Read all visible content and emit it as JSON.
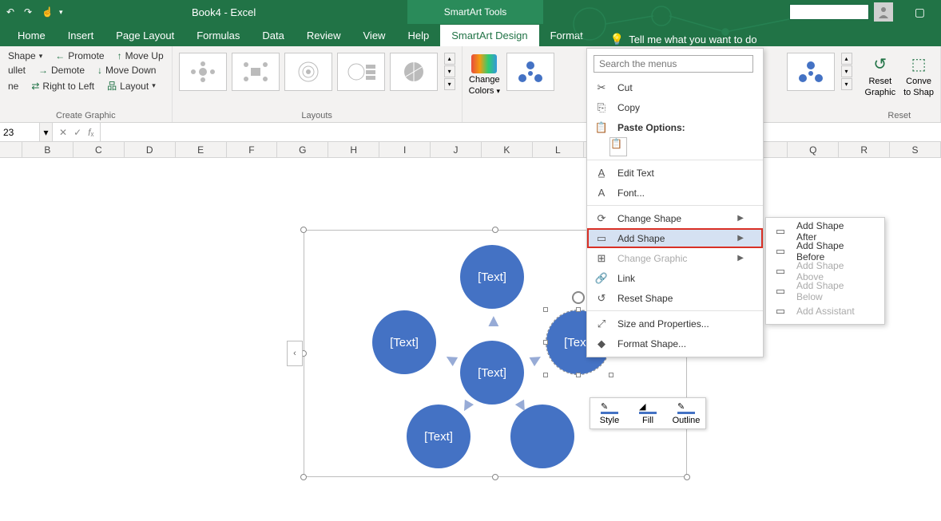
{
  "titlebar": {
    "doc_title": "Book4  -  Excel",
    "context_tool": "SmartArt Tools"
  },
  "tabs": {
    "items": [
      "Home",
      "Insert",
      "Page Layout",
      "Formulas",
      "Data",
      "Review",
      "View",
      "Help",
      "SmartArt Design",
      "Format"
    ],
    "active_index": 8,
    "tell_me": "Tell me what you want to do"
  },
  "ribbon": {
    "create_graphic": {
      "label": "Create Graphic",
      "add_shape": "Shape",
      "bullet": "ullet",
      "pane": "ne",
      "promote": "Promote",
      "demote": "Demote",
      "rtl": "Right to Left",
      "move_up": "Move Up",
      "move_down": "Move Down",
      "layout": "Layout"
    },
    "layouts_label": "Layouts",
    "change_colors": {
      "line1": "Change",
      "line2": "Colors"
    },
    "reset": {
      "label": "Reset",
      "reset_graphic_l1": "Reset",
      "reset_graphic_l2": "Graphic",
      "convert_l1": "Conve",
      "convert_l2": "to Shap"
    }
  },
  "namebox": "23",
  "columns": [
    "B",
    "C",
    "D",
    "E",
    "F",
    "G",
    "H",
    "I",
    "J",
    "K",
    "L",
    "",
    "",
    "",
    "",
    "Q",
    "R",
    "S"
  ],
  "smartart": {
    "placeholder": "[Text]"
  },
  "context_menu": {
    "search_ph": "Search the menus",
    "cut": "Cut",
    "copy": "Copy",
    "paste_options": "Paste Options:",
    "edit_text": "Edit Text",
    "font": "Font...",
    "change_shape": "Change Shape",
    "add_shape": "Add Shape",
    "change_graphic": "Change Graphic",
    "link": "Link",
    "reset_shape": "Reset Shape",
    "size_props": "Size and Properties...",
    "format_shape": "Format Shape..."
  },
  "submenu": {
    "after": "Add Shape After",
    "before": "Add Shape Before",
    "above": "Add Shape Above",
    "below": "Add Shape Below",
    "assistant": "Add Assistant"
  },
  "mini_toolbar": {
    "style": "Style",
    "fill": "Fill",
    "outline": "Outline"
  }
}
